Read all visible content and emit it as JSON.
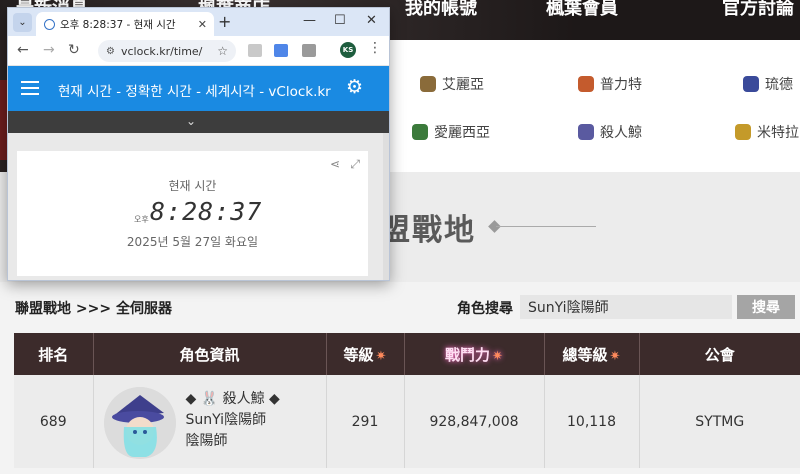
{
  "site": {
    "nav": [
      "最新消息",
      "楓葉商店",
      "我的帳號",
      "楓葉會員",
      "官方討論"
    ],
    "servers": [
      {
        "name": "艾麗亞",
        "icon": "aria-icon",
        "color": "#8a6b3a"
      },
      {
        "name": "普力特",
        "icon": "plute-icon",
        "color": "#c45b2d"
      },
      {
        "name": "琉德",
        "icon": "luna-icon",
        "color": "#3a4a9a"
      },
      {
        "name": "愛麗西亞",
        "icon": "elysium-icon",
        "color": "#3b7a3b"
      },
      {
        "name": "殺人鯨",
        "icon": "orca-icon",
        "color": "#5a5aa0"
      },
      {
        "name": "米特拉",
        "icon": "mitra-icon",
        "color": "#c49a2a"
      }
    ],
    "section_title": "盟戰地",
    "breadcrumb": "聯盟戰地 >>> 全伺服器",
    "search_label": "角色搜尋",
    "search_value": "SunYi陰陽師",
    "search_button": "搜尋",
    "table": {
      "headers": [
        "排名",
        "角色資訊",
        "等級",
        "戰鬥力",
        "總等級",
        "公會"
      ],
      "row": {
        "rank": "689",
        "server": "◆ 🐰 殺人鯨 ◆",
        "name": "SunYi陰陽師",
        "job": "陰陽師",
        "level": "291",
        "power": "928,847,008",
        "total_level": "10,118",
        "guild": "SYTMG"
      }
    }
  },
  "popup": {
    "tab_title": "오후 8:28:37 - 현재 시간",
    "url": "vclock.kr/time/",
    "profile_initials": "KS",
    "header_title": "현재 시간 - 정확한 시간 - 세계시각 - vClock.kr",
    "clock_label": "현재 시간",
    "ampm": "오후",
    "time": "8:28:37",
    "date": "2025년 5월 27일 화요일"
  }
}
